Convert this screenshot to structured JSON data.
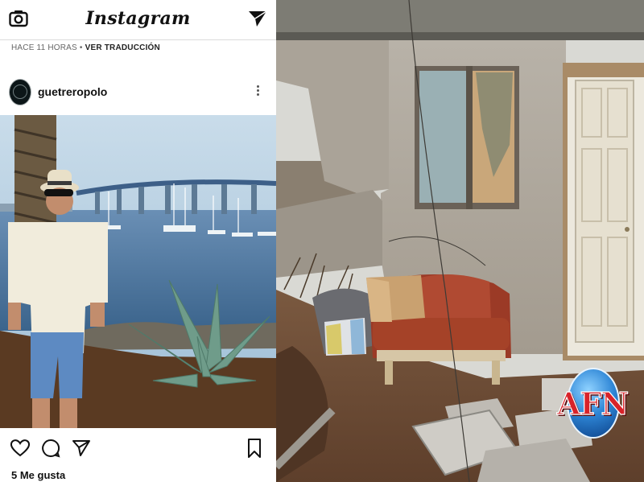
{
  "instagram": {
    "header": {
      "logo": "Instagram"
    },
    "meta": {
      "time": "HACE 11 HORAS",
      "separator": "•",
      "translate": "VER TRADUCCIÓN"
    },
    "post": {
      "username": "guetreropolo"
    },
    "footer": {
      "likes": "5 Me gusta"
    }
  },
  "icons": {
    "camera": "camera-icon",
    "direct": "paper-plane-icon",
    "more": "more-dots-icon",
    "like": "heart-icon",
    "comment": "comment-bubble-icon",
    "share": "paper-plane-icon",
    "save": "bookmark-icon"
  },
  "watermark": {
    "text": "AFN"
  },
  "colors": {
    "ig_border": "#dbdbdb",
    "afn_red": "#d8232a",
    "afn_blue": "#2e86d6"
  }
}
